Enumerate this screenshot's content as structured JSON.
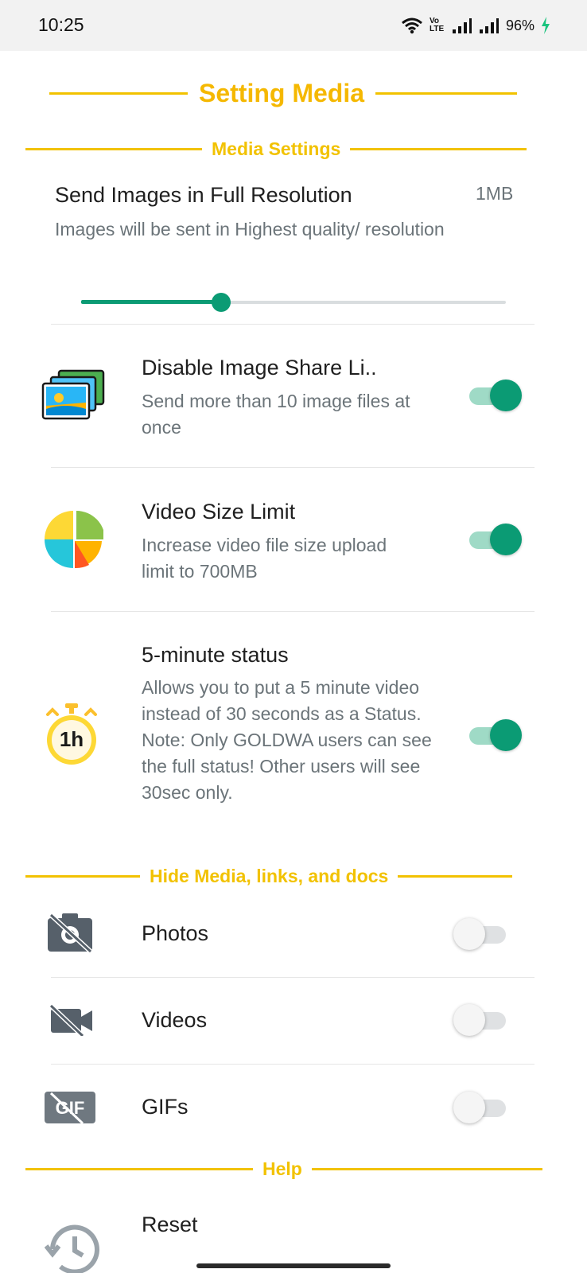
{
  "status_bar": {
    "time": "10:25",
    "volte_label": "Vo LTE",
    "battery": "96%"
  },
  "page_title": "Setting Media",
  "sections": {
    "media_settings": "Media Settings",
    "hide_media": "Hide Media, links, and docs",
    "help": "Help"
  },
  "full_resolution": {
    "title": "Send Images in Full Resolution",
    "value": "1MB",
    "subtitle": "Images will be sent in Highest quality/ resolution",
    "slider_fraction": 0.33
  },
  "image_share": {
    "icon": "images-stack-icon",
    "title": "Disable Image Share Li..",
    "subtitle": "Send more than 10 image files at once",
    "enabled": true
  },
  "video_size": {
    "icon": "pie-chart-icon",
    "title": "Video Size Limit",
    "subtitle": "Increase video file size upload limit to 700MB",
    "enabled": true
  },
  "status_5min": {
    "icon": "stopwatch-icon",
    "icon_text": "1h",
    "title": "5-minute status",
    "subtitle": "Allows you to put a 5 minute video instead of 30 seconds as a Status. Note: Only GOLDWA users can see the full status! Other users will see 30sec only.",
    "enabled": true
  },
  "hide_items": [
    {
      "icon": "camera-off-icon",
      "label": "Photos",
      "enabled": false
    },
    {
      "icon": "video-off-icon",
      "label": "Videos",
      "enabled": false
    },
    {
      "icon": "gif-off-icon",
      "icon_text": "GIF",
      "label": "GIFs",
      "enabled": false
    }
  ],
  "reset": {
    "icon": "history-icon",
    "title": "Reset"
  },
  "colors": {
    "accent_yellow": "#f2c200",
    "toggle_on": "#0b9b74",
    "toggle_track_on": "#9fdac6",
    "muted_text": "#6b7479"
  }
}
